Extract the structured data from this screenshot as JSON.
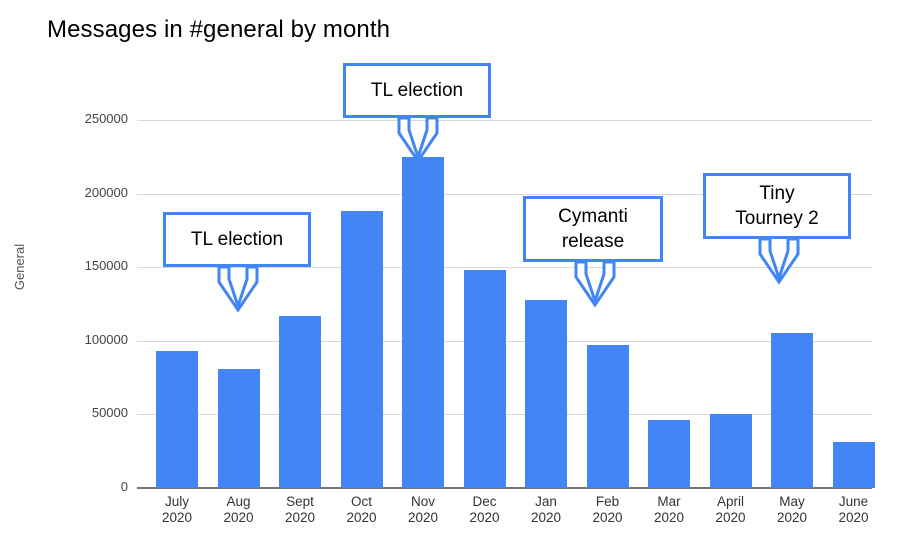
{
  "chart": {
    "title": "Messages in #general by month",
    "y_axis_title": "General"
  },
  "colors": {
    "bar": "#4285f4",
    "callout_border": "#4285f4",
    "gridline": "#d9d9d9",
    "axis": "#757575",
    "text": "#000000"
  },
  "chart_data": {
    "type": "bar",
    "title": "Messages in #general by month",
    "xlabel": "",
    "ylabel": "General",
    "ylim": [
      0,
      250000
    ],
    "ytick_labels": [
      "0",
      "50000",
      "100000",
      "150000",
      "200000",
      "250000"
    ],
    "yticks": [
      0,
      50000,
      100000,
      150000,
      200000,
      250000
    ],
    "grid": true,
    "legend": false,
    "categories": [
      "July\n2020",
      "Aug\n2020",
      "Sept\n2020",
      "Oct\n2020",
      "Nov\n2020",
      "Dec\n2020",
      "Jan\n2020",
      "Feb\n2020",
      "Mar\n2020",
      "April\n2020",
      "May\n2020",
      "June\n2020"
    ],
    "category_lines": [
      {
        "month": "July",
        "year": "2020"
      },
      {
        "month": "Aug",
        "year": "2020"
      },
      {
        "month": "Sept",
        "year": "2020"
      },
      {
        "month": "Oct",
        "year": "2020"
      },
      {
        "month": "Nov",
        "year": "2020"
      },
      {
        "month": "Dec",
        "year": "2020"
      },
      {
        "month": "Jan",
        "year": "2020"
      },
      {
        "month": "Feb",
        "year": "2020"
      },
      {
        "month": "Mar",
        "year": "2020"
      },
      {
        "month": "April",
        "year": "2020"
      },
      {
        "month": "May",
        "year": "2020"
      },
      {
        "month": "June",
        "year": "2020"
      }
    ],
    "values": [
      93000,
      81000,
      117000,
      188000,
      225000,
      148000,
      128000,
      97000,
      46000,
      50000,
      105000,
      31000
    ],
    "annotations": [
      {
        "label": "TL election",
        "lines": [
          "TL election"
        ],
        "target_category": "Aug\n2020"
      },
      {
        "label": "TL election",
        "lines": [
          "TL election"
        ],
        "target_category": "Nov\n2020"
      },
      {
        "label": "Cymanti release",
        "lines": [
          "Cymanti",
          "release"
        ],
        "target_category": "Feb\n2020"
      },
      {
        "label": "Tiny Tourney 2",
        "lines": [
          "Tiny",
          "Tourney 2"
        ],
        "target_category": "May\n2020"
      }
    ]
  }
}
